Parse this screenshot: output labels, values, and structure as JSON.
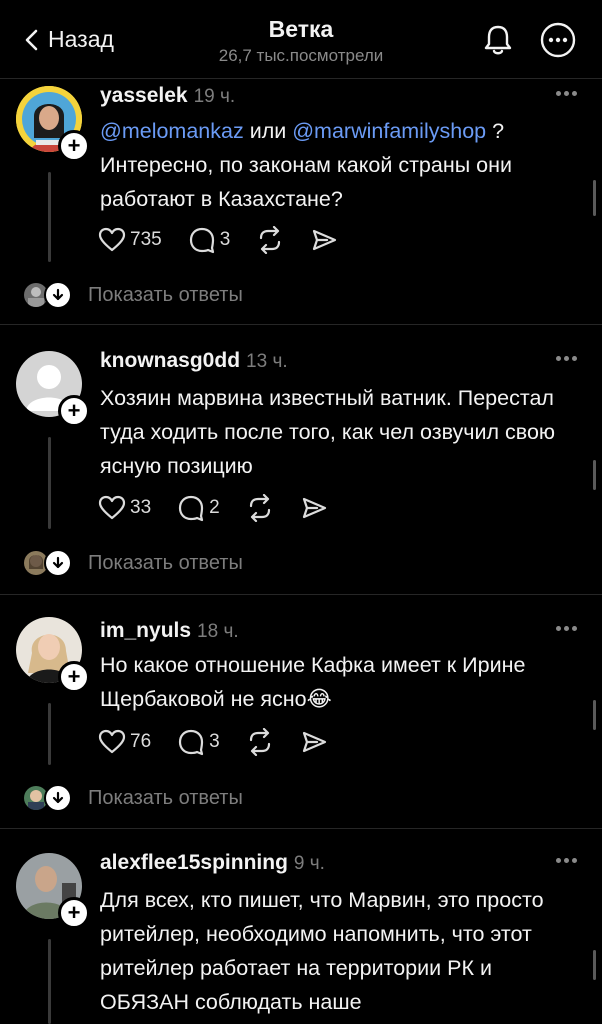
{
  "header": {
    "back_label": "Назад",
    "title": "Ветка",
    "views": "26,7 тыс.посмотрели"
  },
  "posts": [
    {
      "username": "yasselek",
      "time": "19 ч.",
      "text_parts": {
        "mention1": "@melomankaz",
        "mid": " или ",
        "mention2": "@marwinfamilyshop",
        "tail": " ?"
      },
      "text_rest": "Интересно, по законам какой страны они работают в Казахстане?",
      "likes": "735",
      "comments": "3",
      "show_replies": "Показать ответы"
    },
    {
      "username": "knownasg0dd",
      "time": "13 ч.",
      "text": "Хозяин марвина известный ватник. Перестал туда ходить после того, как чел озвучил свою ясную позицию",
      "likes": "33",
      "comments": "2",
      "show_replies": "Показать ответы"
    },
    {
      "username": "im_nyuls",
      "time": "18 ч.",
      "text": "Но какое отношение Кафка имеет к Ирине Щербаковой не ясно",
      "emoji": "😂",
      "likes": "76",
      "comments": "3",
      "show_replies": "Показать ответы"
    },
    {
      "username": "alexflee15spinning",
      "time": "9 ч.",
      "text": "Для всех, кто пишет, что Марвин, это просто ритейлер, необходимо напомнить, что этот ритейлер работает на территории РК и ОБЯЗАН соблюдать наше"
    }
  ]
}
